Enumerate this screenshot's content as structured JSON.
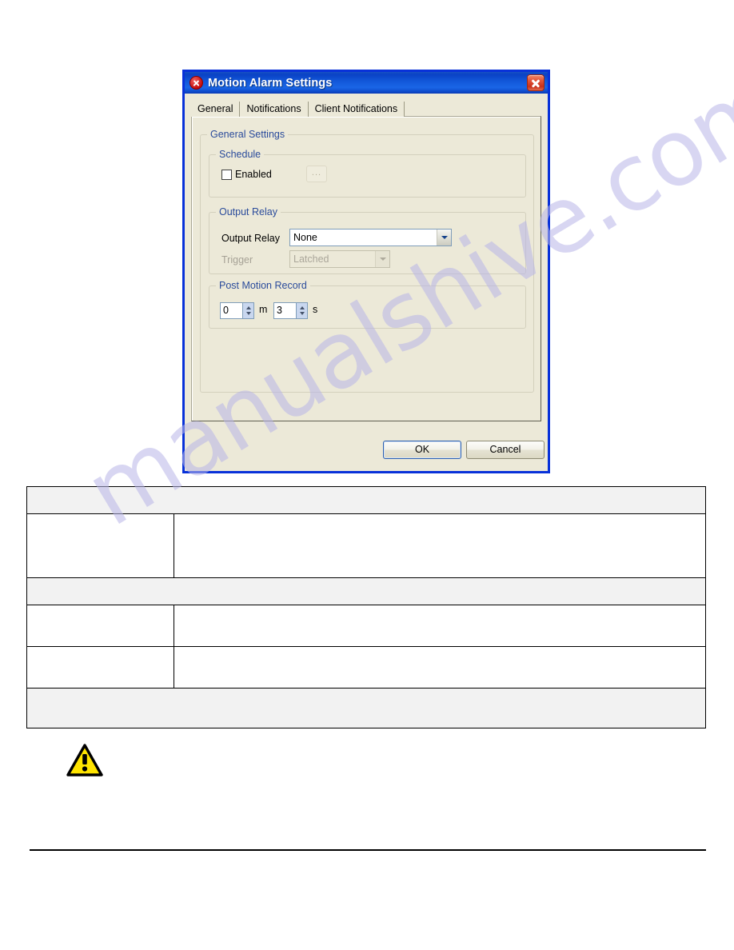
{
  "dialog": {
    "title": "Motion Alarm Settings",
    "title_icon": "error-circle-icon",
    "close_icon": "close-icon",
    "tabs": [
      {
        "label": "General",
        "selected": true
      },
      {
        "label": "Notifications",
        "selected": false
      },
      {
        "label": "Client Notifications",
        "selected": false
      }
    ],
    "general_settings": {
      "group_label": "General Settings",
      "schedule": {
        "group_label": "Schedule",
        "enabled_label": "Enabled",
        "enabled_checked": false,
        "browse_button_label": "..."
      },
      "output_relay": {
        "group_label": "Output Relay",
        "relay_field_label": "Output Relay",
        "relay_value": "None",
        "trigger_field_label": "Trigger",
        "trigger_value": "Latched",
        "trigger_disabled": true
      },
      "post_motion_record": {
        "group_label": "Post Motion Record",
        "minutes_value": "0",
        "minutes_unit": "m",
        "seconds_value": "3",
        "seconds_unit": "s"
      }
    },
    "buttons": {
      "ok_label": "OK",
      "cancel_label": "Cancel"
    }
  },
  "page": {
    "watermark_text": "manualshive.com",
    "warning_icon": "warning-triangle-icon",
    "table": {
      "rows": [
        {
          "type": "header",
          "cells": [
            ""
          ]
        },
        {
          "type": "body",
          "cells": [
            "",
            ""
          ]
        },
        {
          "type": "header",
          "cells": [
            ""
          ]
        },
        {
          "type": "body",
          "cells": [
            "",
            ""
          ]
        },
        {
          "type": "body",
          "cells": [
            "",
            ""
          ]
        },
        {
          "type": "header",
          "cells": [
            ""
          ]
        }
      ]
    }
  },
  "colors": {
    "titlebar_blue": "#0a43c6",
    "dialog_face": "#ece9d8",
    "group_label_blue": "#2a4b9b",
    "close_red": "#c8301a",
    "warning_yellow": "#ffe400",
    "watermark": "#b9b6e8"
  }
}
